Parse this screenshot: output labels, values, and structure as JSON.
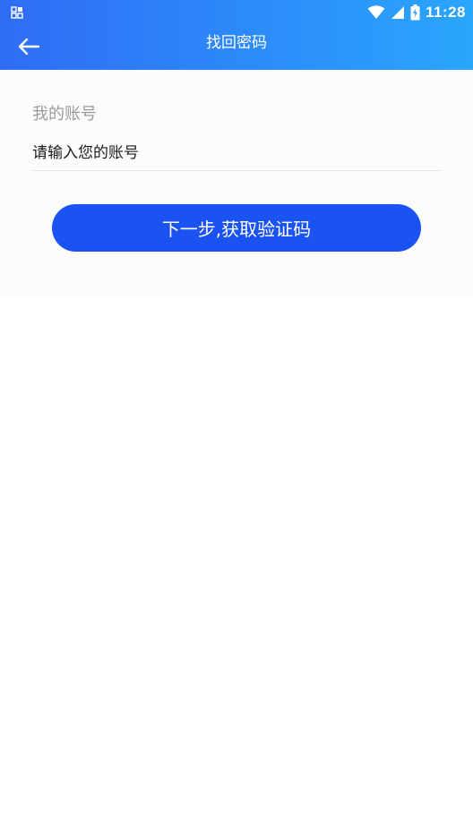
{
  "status_bar": {
    "time": "11:28",
    "icons": [
      "qr-grid-icon",
      "wifi-icon",
      "cellular-signal-icon",
      "battery-charging-icon"
    ]
  },
  "toolbar": {
    "back_icon": "arrow-left-icon",
    "title": "找回密码"
  },
  "form": {
    "account_label": "我的账号",
    "account_placeholder": "请输入您的账号",
    "account_value": ""
  },
  "actions": {
    "next_button_label": "下一步,获取验证码"
  },
  "colors": {
    "header_gradient_start": "#2f6cf6",
    "header_gradient_end": "#2aa6fd",
    "primary_button": "#1b53f2"
  }
}
